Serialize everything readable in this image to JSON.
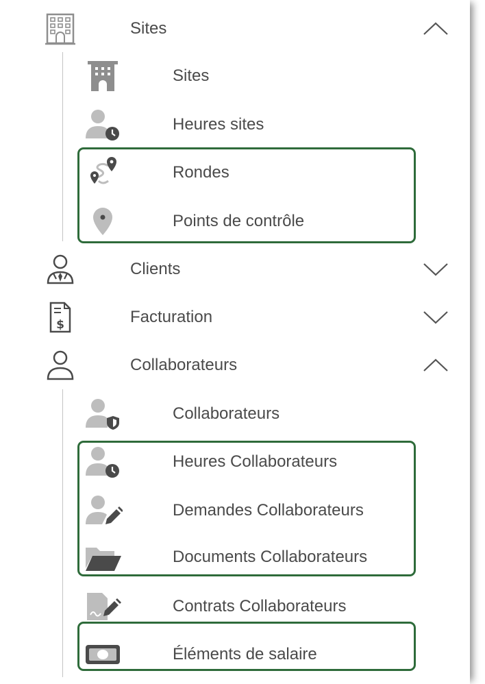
{
  "colors": {
    "icon": "#8e8e8e",
    "text": "#4a4a4a",
    "highlight": "#2e6b3a",
    "guide": "#c4c4c4"
  },
  "menu": {
    "sites": {
      "label": "Sites",
      "icon": "building-grid-icon",
      "state": "expanded",
      "children": [
        {
          "label": "Sites",
          "icon": "building-icon"
        },
        {
          "label": "Heures sites",
          "icon": "user-clock-icon"
        },
        {
          "label": "Rondes",
          "icon": "route-icon"
        },
        {
          "label": "Points de contrôle",
          "icon": "map-pin-icon"
        }
      ]
    },
    "clients": {
      "label": "Clients",
      "icon": "client-tie-icon",
      "state": "collapsed"
    },
    "facturation": {
      "label": "Facturation",
      "icon": "invoice-dollar-icon",
      "state": "collapsed"
    },
    "collaborateurs": {
      "label": "Collaborateurs",
      "icon": "user-outline-icon",
      "state": "expanded",
      "children": [
        {
          "label": "Collaborateurs",
          "icon": "user-shield-icon"
        },
        {
          "label": "Heures Collaborateurs",
          "icon": "user-clock-icon"
        },
        {
          "label": "Demandes Collaborateurs",
          "icon": "user-pen-icon"
        },
        {
          "label": "Documents Collaborateurs",
          "icon": "folder-open-icon"
        },
        {
          "label": "Contrats Collaborateurs",
          "icon": "contract-sign-icon"
        },
        {
          "label": "Éléments de salaire",
          "icon": "money-bill-icon"
        }
      ]
    }
  }
}
